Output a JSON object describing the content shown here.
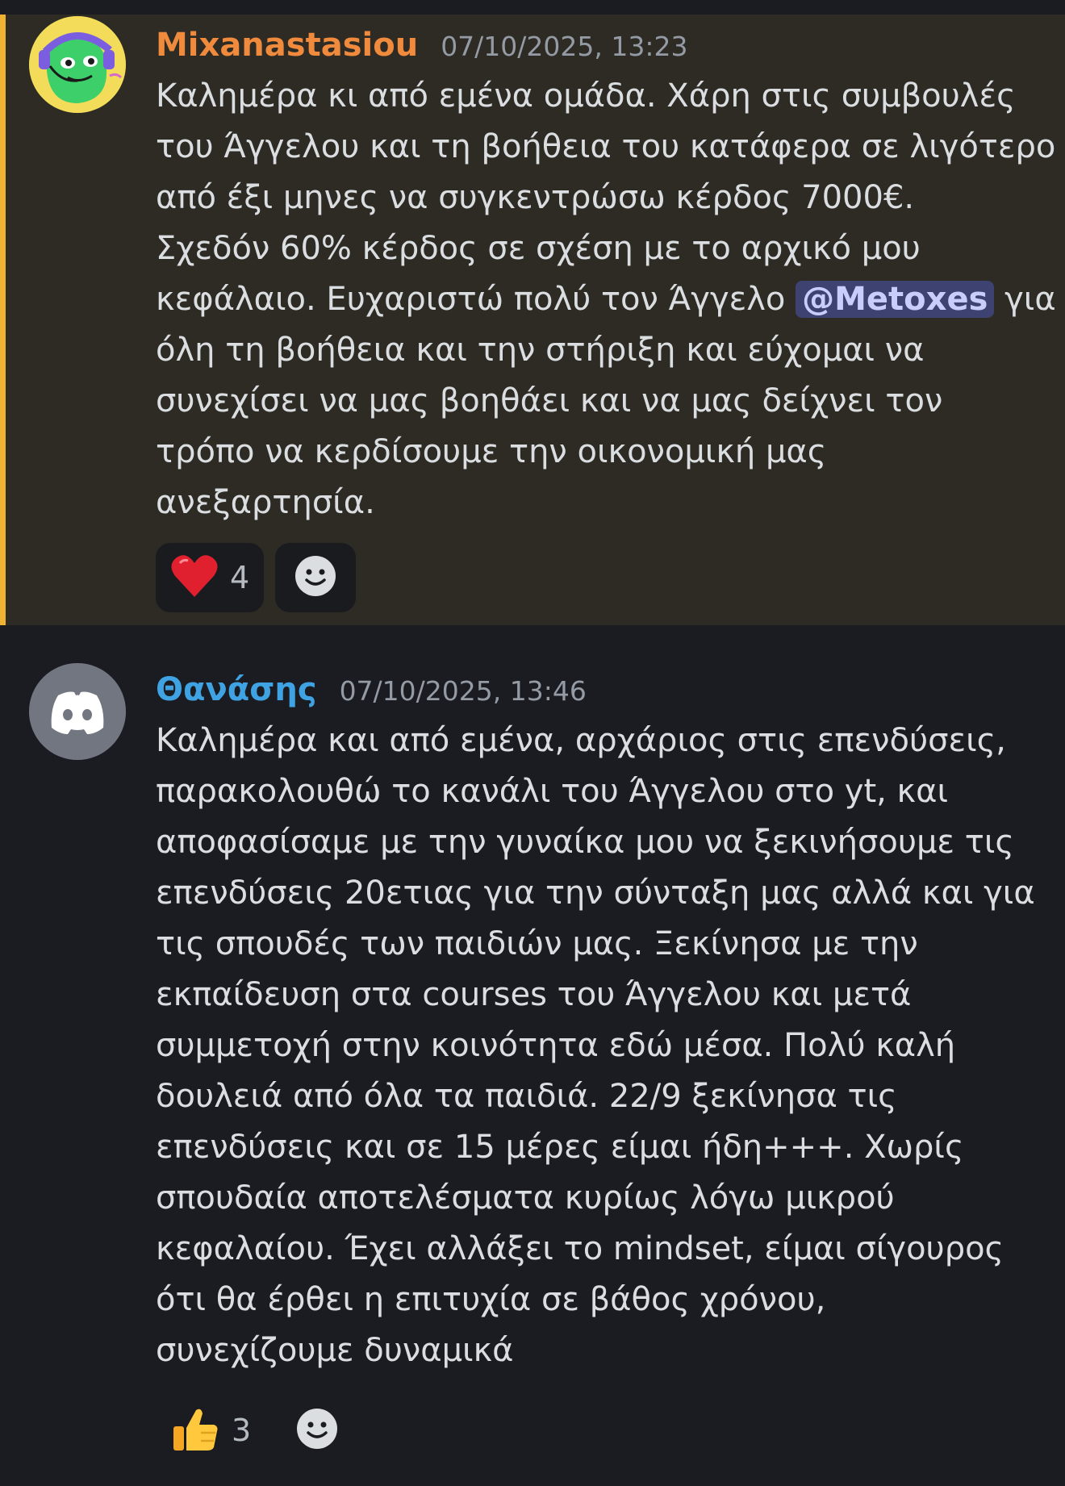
{
  "messages": [
    {
      "username": "Mixanastasiou",
      "timestamp": "07/10/2025, 13:23",
      "lines": [
        "Καλημέρα κι από εμένα ομάδα. Χάρη στις συμβουλές",
        "του Άγγελου και τη βοήθεια του κατάφερα σε λιγότερο",
        "από έξι μηνες να συγκεντρώσω κέρδος 7000€.",
        "Σχεδόν 60% κέρδος σε σχέση με το αρχικό μου",
        "κεφάλαιο. Ευχαριστώ πολύ τον Άγγελο",
        "όλη τη βοήθεια και την στήριξη και εύχομαι να",
        "συνεχίσει να μας βοηθάει και να μας δείχνει τον",
        "τρόπο να κερδίσουμε την οικονομική μας",
        "ανεξαρτησία."
      ],
      "mention": "@Metoxes",
      "after_mention": "για",
      "reactions": [
        {
          "emoji": "❤️",
          "count": "4"
        }
      ],
      "accent_color": "#f0b232"
    },
    {
      "username": "Θανάσης",
      "timestamp": "07/10/2025, 13:46",
      "lines": [
        "Καλημέρα και από εμένα, αρχάριος στις επενδύσεις,",
        "παρακολουθώ το κανάλι του Άγγελου στο yt, και",
        "αποφασίσαμε με την γυναίκα μου να ξεκινήσουμε τις",
        "επενδύσεις 20ετιας για την σύνταξη μας αλλά και για",
        "τις σπουδές των παιδιών μας. Ξεκίνησα με την",
        "εκπαίδευση στα courses του Άγγελου και μετά",
        "συμμετοχή στην κοινότητα εδώ μέσα. Πολύ καλή",
        "δουλειά από όλα τα παιδιά. 22/9 ξεκίνησα τις",
        "επενδύσεις και σε 15 μέρες είμαι ήδη+++. Χωρίς",
        "σπουδαία αποτελέσματα κυρίως λόγω μικρού",
        "κεφαλαίου. Έχει αλλάξει το mindset, είμαι σίγουρος",
        "ότι θα έρθει η επιτυχία σε βάθος χρόνου,",
        "συνεχίζουμε δυναμικά"
      ],
      "reactions": [
        {
          "emoji": "👍",
          "count": "3"
        }
      ]
    }
  ],
  "icons": {
    "add_reaction": "smile-face-icon",
    "discord_avatar": "discord-logo-icon"
  }
}
